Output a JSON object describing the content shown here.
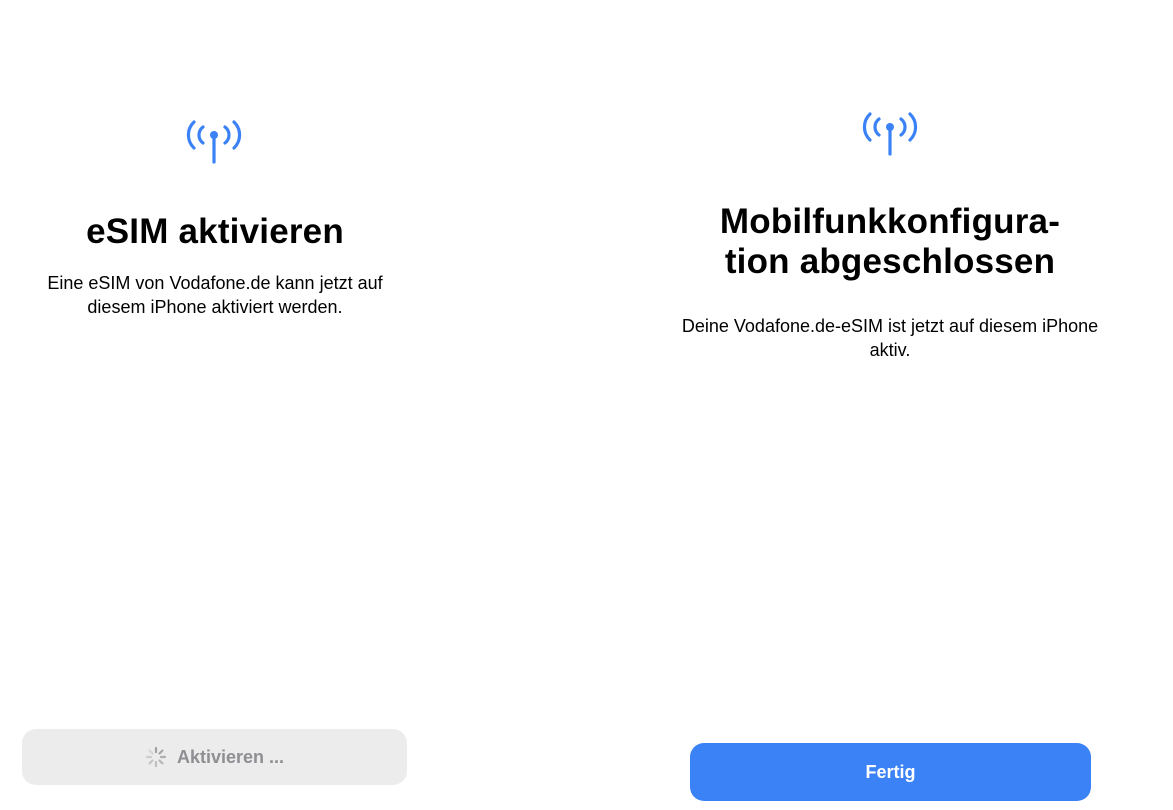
{
  "left_screen": {
    "title": "eSIM aktivieren",
    "description": "Eine eSIM von Vodafone.de kann jetzt auf diesem iPhone aktiviert werden.",
    "button_label": "Aktivieren ...",
    "icon": "cellular-antenna-icon"
  },
  "right_screen": {
    "title": "Mobilfunkkonfigura-\ntion abgeschlossen",
    "description": "Deine Vodafone.de-eSIM ist jetzt auf diesem iPhone aktiv.",
    "button_label": "Fertig",
    "icon": "cellular-antenna-icon"
  },
  "colors": {
    "accent": "#3b82f6",
    "disabled_button_bg": "#ececec",
    "disabled_button_text": "#8e8e93"
  }
}
